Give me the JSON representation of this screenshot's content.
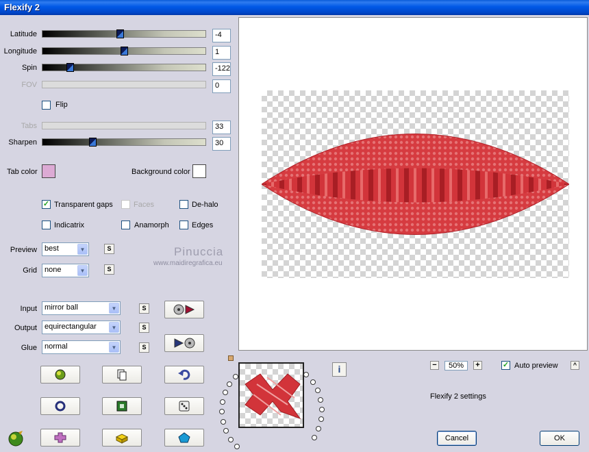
{
  "window": {
    "title": "Flexify 2"
  },
  "sliders": {
    "latitude": {
      "label": "Latitude",
      "value": "-4"
    },
    "longitude": {
      "label": "Longitude",
      "value": "1"
    },
    "spin": {
      "label": "Spin",
      "value": "-122"
    },
    "fov": {
      "label": "FOV",
      "value": "0"
    },
    "tabs": {
      "label": "Tabs",
      "value": "33"
    },
    "sharpen": {
      "label": "Sharpen",
      "value": "30"
    }
  },
  "checkboxes": {
    "flip": {
      "label": "Flip",
      "checked": false
    },
    "transparent_gaps": {
      "label": "Transparent gaps",
      "checked": true
    },
    "faces": {
      "label": "Faces",
      "checked": false
    },
    "de_halo": {
      "label": "De-halo",
      "checked": false
    },
    "indicatrix": {
      "label": "Indicatrix",
      "checked": false
    },
    "anamorph": {
      "label": "Anamorph",
      "checked": false
    },
    "edges": {
      "label": "Edges",
      "checked": false
    },
    "auto_preview": {
      "label": "Auto preview",
      "checked": true
    }
  },
  "colors": {
    "tab_color_label": "Tab color",
    "tab_color": "#dcaad4",
    "background_color_label": "Background color",
    "background_color": "#ffffff"
  },
  "dropdowns": {
    "preview": {
      "label": "Preview",
      "value": "best"
    },
    "grid": {
      "label": "Grid",
      "value": "none"
    },
    "input": {
      "label": "Input",
      "value": "mirror ball"
    },
    "output": {
      "label": "Output",
      "value": "equirectangular"
    },
    "glue": {
      "label": "Glue",
      "value": "normal"
    }
  },
  "s_button_label": "S",
  "watermark": {
    "name": "Pinuccia",
    "site": "www.maidiregrafica.eu"
  },
  "zoom": {
    "value": "50%",
    "minus": "−",
    "plus": "+"
  },
  "status_text": "Flexify 2 settings",
  "buttons": {
    "cancel": "Cancel",
    "ok": "OK",
    "info": "i",
    "collapse": "^"
  }
}
